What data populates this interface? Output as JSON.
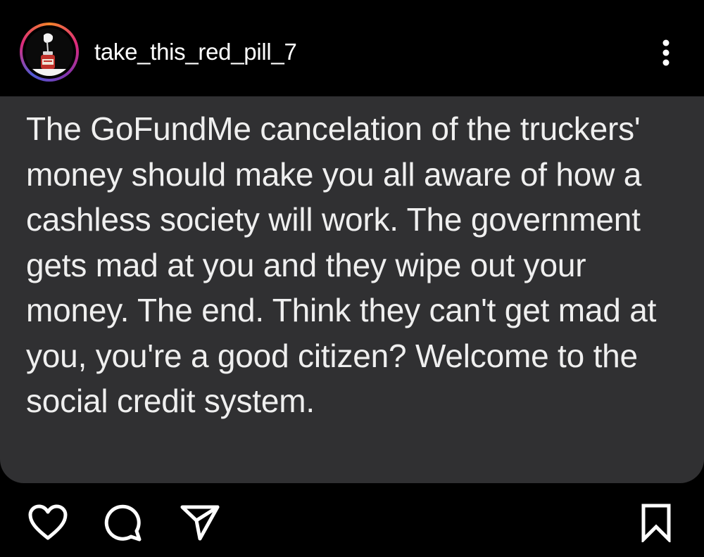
{
  "post": {
    "username": "take_this_red_pill_7",
    "text": "The GoFundMe cancelation of the truckers' money should make you all aware of how a cashless society will work. The government gets mad at you and they wipe out your money. The end. Think they can't get mad at you, you're a good citizen? Welcome to the social credit system."
  },
  "icons": {
    "avatar": "red-pill-bottle-icon",
    "more": "more-vertical-icon",
    "like": "heart-icon",
    "comment": "comment-bubble-icon",
    "share": "paper-plane-icon",
    "save": "bookmark-icon"
  },
  "colors": {
    "background": "#000000",
    "card": "#303032",
    "text": "#efefef"
  }
}
